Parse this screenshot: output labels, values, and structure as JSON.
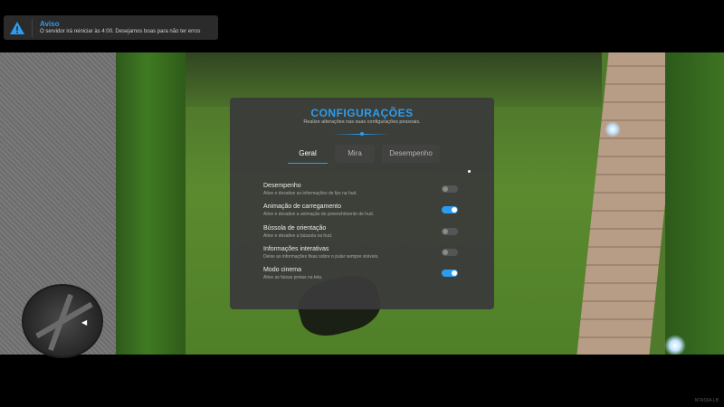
{
  "toast": {
    "title": "Aviso",
    "message": "O servidor irá reiniciar às 4:00. Desejamos boas para não ter erros",
    "icon": "warning-icon",
    "accent": "#2d9cf0"
  },
  "settings": {
    "title": "CONFIGURAÇÕES",
    "subtitle": "Realize alterações nas suas configurações pessoais.",
    "tabs": [
      {
        "label": "Geral",
        "active": true
      },
      {
        "label": "Mira",
        "active": false
      },
      {
        "label": "Desempenho",
        "active": false
      }
    ],
    "options": [
      {
        "label": "Desempenho",
        "description": "Ative e desative as informações de fps na hud.",
        "enabled": false
      },
      {
        "label": "Animação de carregamento",
        "description": "Ative e desative a animação de preenchimento de hud.",
        "enabled": true
      },
      {
        "label": "Bússola de orientação",
        "description": "Ative e desative a bússola na hud.",
        "enabled": false
      },
      {
        "label": "Informações interativas",
        "description": "Deixe as informações fixas sobre o pular sempre visíveis.",
        "enabled": false
      },
      {
        "label": "Modo cinema",
        "description": "Ative as faixas pretas na tela.",
        "enabled": true
      }
    ]
  },
  "watermark": "NTAS5A LB",
  "colors": {
    "accent": "#2d9cf0",
    "panel": "#3a3a3a"
  }
}
